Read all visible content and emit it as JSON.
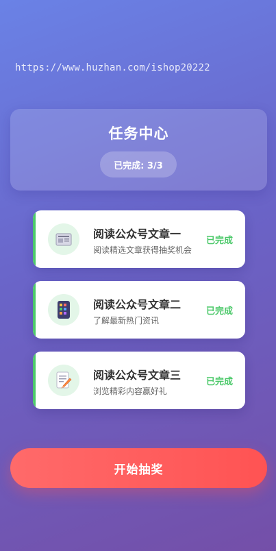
{
  "watermark": "https://www.huzhan.com/ishop20222",
  "header": {
    "title": "任务中心",
    "progress": "已完成: 3/3"
  },
  "tasks": [
    {
      "title": "阅读公众号文章一",
      "subtitle": "阅读精选文章获得抽奖机会",
      "status": "已完成",
      "icon": "newspaper-icon"
    },
    {
      "title": "阅读公众号文章二",
      "subtitle": "了解最新热门资讯",
      "status": "已完成",
      "icon": "phone-icon"
    },
    {
      "title": "阅读公众号文章三",
      "subtitle": "浏览精彩内容赢好礼",
      "status": "已完成",
      "icon": "memo-icon"
    }
  ],
  "cta": {
    "label": "开始抽奖"
  },
  "colors": {
    "accent_green": "#4cc96a",
    "cta_red": "#ff5a5a"
  }
}
